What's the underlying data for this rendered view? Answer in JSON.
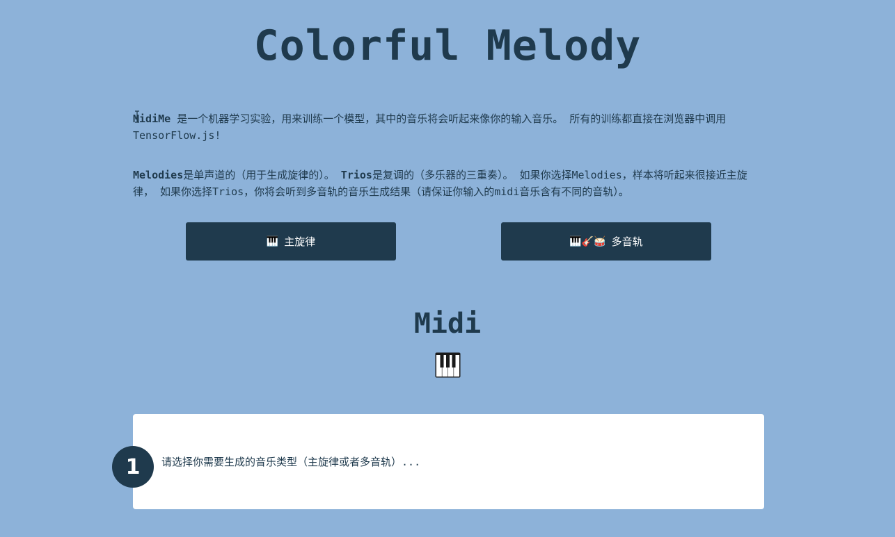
{
  "page": {
    "title": "Colorful Melody"
  },
  "intro": {
    "p1_brand": "MidiMe",
    "p1_text": " 是一个机器学习实验，用来训练一个模型，其中的音乐将会听起来像你的输入音乐。 所有的训练都直接在浏览器中调用TensorFlow.js!",
    "p2_melodies": "Melodies",
    "p2_text_a": "是单声道的（用于生成旋律的）。 ",
    "p2_trios": "Trios",
    "p2_text_b": "是复调的（多乐器的三重奏）。 如果你选择Melodies，样本将听起来很接近主旋律， 如果你选择Trios，你将会听到多音轨的音乐生成结果（请保证你输入的midi音乐含有不同的音轨）。"
  },
  "buttons": {
    "melody": {
      "icon": "🎹",
      "label": "主旋律"
    },
    "trio": {
      "icon": "🎹🎸🥁",
      "label": "多音轨"
    }
  },
  "midi_section": {
    "heading": "Midi",
    "icon": "piano-keys-icon"
  },
  "step": {
    "number": "1",
    "text": "请选择你需要生成的音乐类型（主旋律或者多音轨）..."
  },
  "colors": {
    "background": "#8db2d9",
    "primary": "#1f3a4d",
    "card": "#ffffff"
  }
}
